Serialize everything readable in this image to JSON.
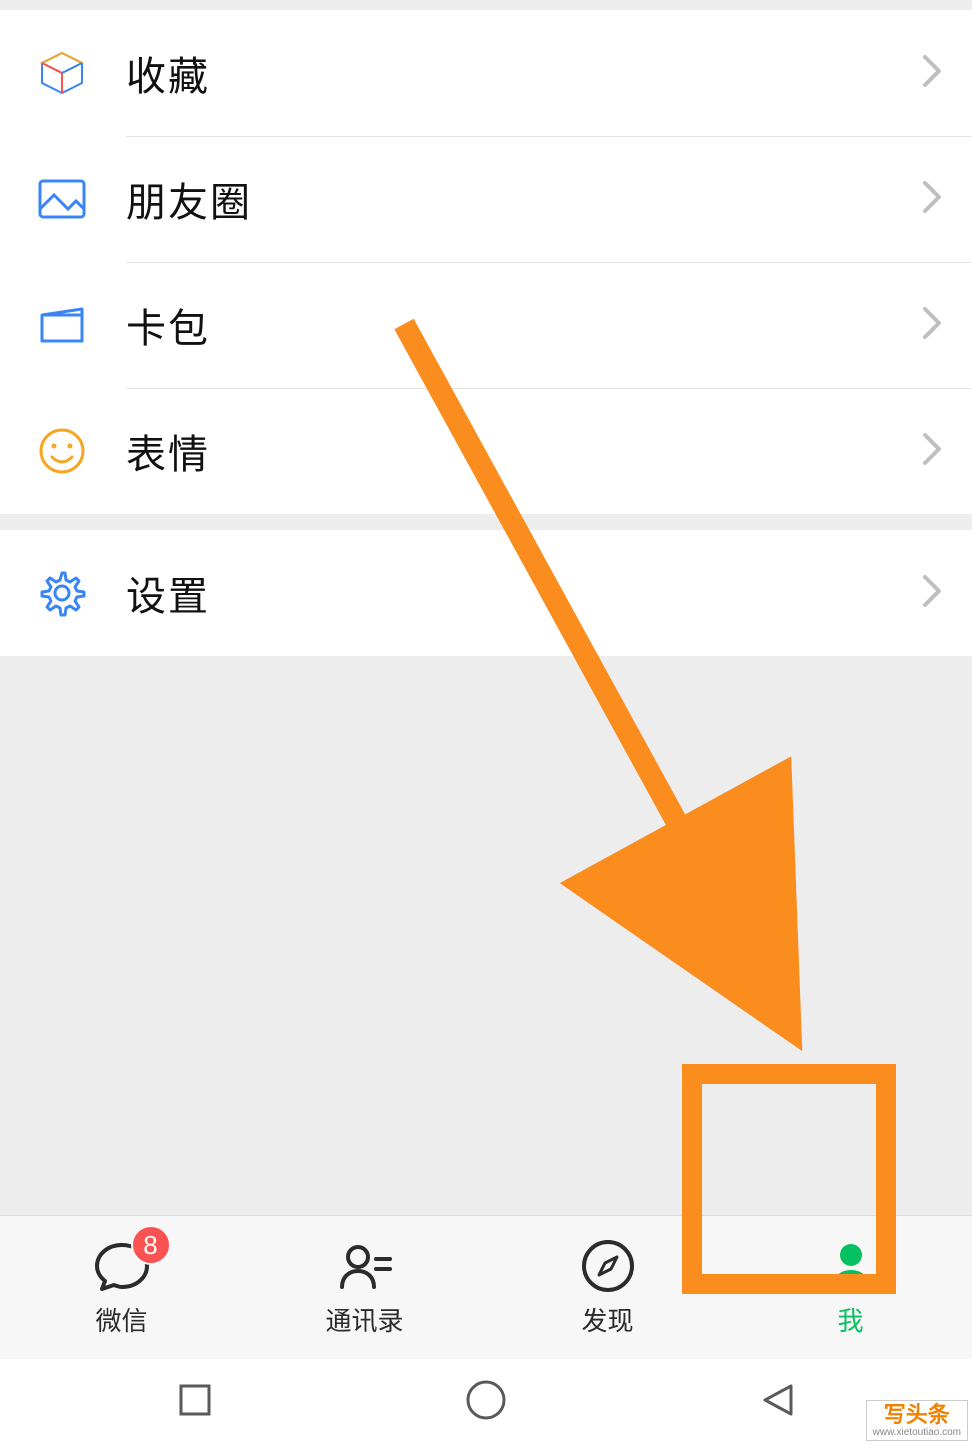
{
  "menu": {
    "favorites": "收藏",
    "moments": "朋友圈",
    "cards": "卡包",
    "stickers": "表情",
    "settings": "设置"
  },
  "tabs": {
    "chats": "微信",
    "contacts": "通讯录",
    "discover": "发现",
    "me": "我",
    "chat_badge": "8"
  },
  "watermark": {
    "line1": "写头条",
    "line2": "www.xietoutiao.com"
  },
  "colors": {
    "accent": "#07c160",
    "annotation": "#fb8c1e",
    "badge": "#fa5151",
    "icon_blue": "#3985f6",
    "icon_orange": "#f5a623"
  }
}
